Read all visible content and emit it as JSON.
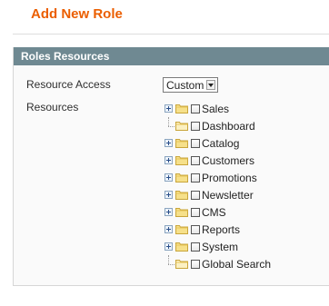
{
  "page": {
    "title": "Add New Role"
  },
  "panel": {
    "header": "Roles Resources",
    "resource_access_label": "Resource Access",
    "resource_access_value": "Custom",
    "resources_label": "Resources"
  },
  "tree": {
    "items": [
      {
        "label": "Sales",
        "type": "expandable",
        "icon": "folder-icon"
      },
      {
        "label": "Dashboard",
        "type": "leaf",
        "icon": "folder-leaf-icon"
      },
      {
        "label": "Catalog",
        "type": "expandable",
        "icon": "folder-icon"
      },
      {
        "label": "Customers",
        "type": "expandable",
        "icon": "folder-icon"
      },
      {
        "label": "Promotions",
        "type": "expandable",
        "icon": "folder-icon"
      },
      {
        "label": "Newsletter",
        "type": "expandable",
        "icon": "folder-icon"
      },
      {
        "label": "CMS",
        "type": "expandable",
        "icon": "folder-icon"
      },
      {
        "label": "Reports",
        "type": "expandable",
        "icon": "folder-icon"
      },
      {
        "label": "System",
        "type": "expandable",
        "icon": "folder-icon"
      },
      {
        "label": "Global Search",
        "type": "leaf",
        "icon": "folder-leaf-icon"
      }
    ]
  },
  "colors": {
    "title": "#eb5e00",
    "panel_header_bg": "#6f8992"
  }
}
